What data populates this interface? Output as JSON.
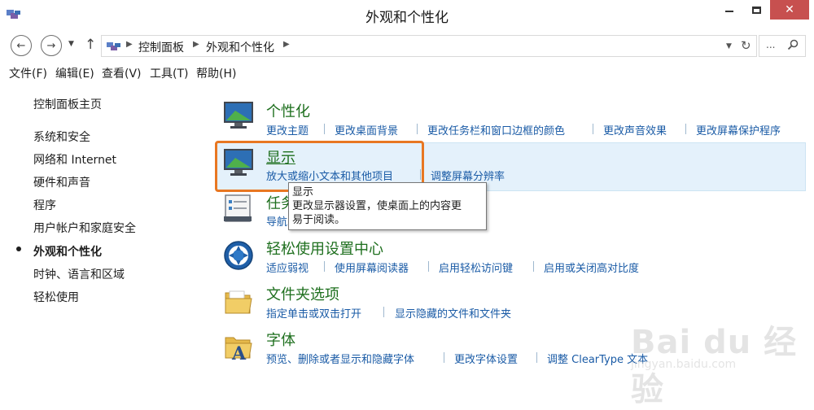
{
  "window": {
    "title": "外观和个性化",
    "controls": [
      "minimize",
      "maximize",
      "close"
    ]
  },
  "address_bar": {
    "breadcrumbs": [
      "控制面板",
      "外观和个性化"
    ]
  },
  "menu": {
    "items": [
      "文件(F)",
      "编辑(E)",
      "查看(V)",
      "工具(T)",
      "帮助(H)"
    ]
  },
  "sidebar": {
    "items": [
      {
        "label": "控制面板主页"
      },
      {
        "label": "系统和安全"
      },
      {
        "label": "网络和 Internet"
      },
      {
        "label": "硬件和声音"
      },
      {
        "label": "程序"
      },
      {
        "label": "用户帐户和家庭安全"
      },
      {
        "label": "外观和个性化",
        "active": true
      },
      {
        "label": "时钟、语言和区域"
      },
      {
        "label": "轻松使用"
      }
    ]
  },
  "categories": [
    {
      "title": "个性化",
      "icon": "personalization-monitor-icon",
      "links": [
        "更改主题",
        "更改桌面背景",
        "更改任务栏和窗口边框的颜色",
        "更改声音效果",
        "更改屏幕保护程序"
      ]
    },
    {
      "title": "显示",
      "icon": "display-monitor-icon",
      "highlighted": true,
      "links": [
        "放大或缩小文本和其他项目",
        "调整屏幕分辨率"
      ]
    },
    {
      "title": "任务",
      "icon": "taskbar-clipboard-icon",
      "links": [
        "导航"
      ]
    },
    {
      "title": "轻松使用设置中心",
      "icon": "ease-of-access-icon",
      "links": [
        "适应弱视",
        "使用屏幕阅读器",
        "启用轻松访问键",
        "启用或关闭高对比度"
      ]
    },
    {
      "title": "文件夹选项",
      "icon": "folder-icon",
      "links": [
        "指定单击或双击打开",
        "显示隐藏的文件和文件夹"
      ]
    },
    {
      "title": "字体",
      "icon": "font-folder-icon",
      "links": [
        "预览、删除或者显示和隐藏字体",
        "更改字体设置",
        "调整 ClearType 文本"
      ]
    }
  ],
  "tooltip": {
    "title": "显示",
    "lines": [
      "更改显示器设置，使桌面上的内容更",
      "易于阅读。"
    ]
  },
  "watermark": {
    "text": "Bai du 经验",
    "url": "jingyan.baidu.com"
  },
  "colors": {
    "highlight_bg": "#e4f1fb",
    "annotation_box": "#e87722",
    "link": "#1a5ba6",
    "category_title": "#1e6f1e",
    "close_button": "#c7504f"
  }
}
